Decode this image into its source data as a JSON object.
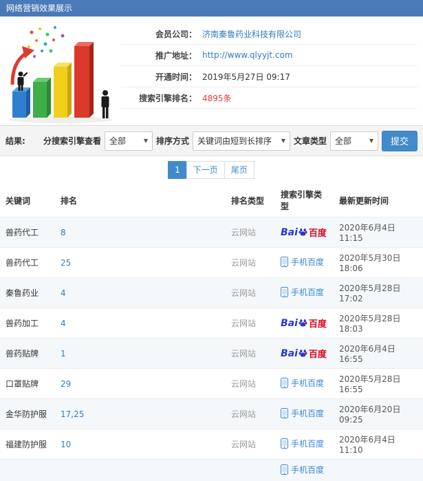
{
  "title_bar": {
    "title": "网络营销效果展示"
  },
  "member": {
    "company_label": "会员公司：",
    "company_value": "济南秦鲁药业科技有限公司",
    "url_label": "推广地址：",
    "url_value": "http://www.qlyyjt.com",
    "open_label": "开通时间：",
    "open_value": "2019年5月27日 09:17",
    "rank_label": "搜索引擎排名：",
    "rank_value": "4895条"
  },
  "filters": {
    "section_label": "结果:",
    "engine_label": "分搜索引擎查看",
    "engine_value": "全部",
    "sort_label": "排序方式",
    "sort_value": "关键词由短到长排序",
    "article_label": "文章类型",
    "article_value": "全部",
    "submit_label": "提交"
  },
  "pagination": {
    "current": "1",
    "next": "下一页",
    "last": "尾页"
  },
  "engines": {
    "baidu_en": "Bai",
    "baidu_cn": "百度",
    "mobile_label": "手机百度"
  },
  "table": {
    "headers": [
      "关键词",
      "排名",
      "排名类型",
      "搜索引擎类型",
      "最新更新时间"
    ],
    "rows": [
      {
        "keyword": "兽药代工",
        "rank": "8",
        "rank_type": "云网站",
        "engine": "baidu",
        "time": "2020年6月4日 11:15"
      },
      {
        "keyword": "兽药代工",
        "rank": "25",
        "rank_type": "云网站",
        "engine": "mobile",
        "time": "2020年5月30日 18:06"
      },
      {
        "keyword": "秦鲁药业",
        "rank": "4",
        "rank_type": "云网站",
        "engine": "mobile",
        "time": "2020年5月28日 17:02"
      },
      {
        "keyword": "兽药加工",
        "rank": "4",
        "rank_type": "云网站",
        "engine": "baidu",
        "time": "2020年5月28日 18:03"
      },
      {
        "keyword": "兽药贴牌",
        "rank": "1",
        "rank_type": "云网站",
        "engine": "baidu",
        "time": "2020年6月4日 16:55"
      },
      {
        "keyword": "口罩贴牌",
        "rank": "29",
        "rank_type": "云网站",
        "engine": "mobile",
        "time": "2020年5月28日 16:55"
      },
      {
        "keyword": "金华防护服",
        "rank": "17,25",
        "rank_type": "云网站",
        "engine": "mobile",
        "time": "2020年6月20日 09:25"
      },
      {
        "keyword": "福建防护服",
        "rank": "10",
        "rank_type": "云网站",
        "engine": "mobile",
        "time": "2020年6月4日 11:10"
      },
      {
        "keyword": "",
        "rank": "",
        "rank_type": "",
        "engine": "mobile",
        "time": ""
      }
    ]
  },
  "colors": {
    "accent_blue": "#428bca",
    "link_blue": "#2e7cc3",
    "danger_red": "#e4393c",
    "titlebar_blue": "#4a79b8"
  }
}
